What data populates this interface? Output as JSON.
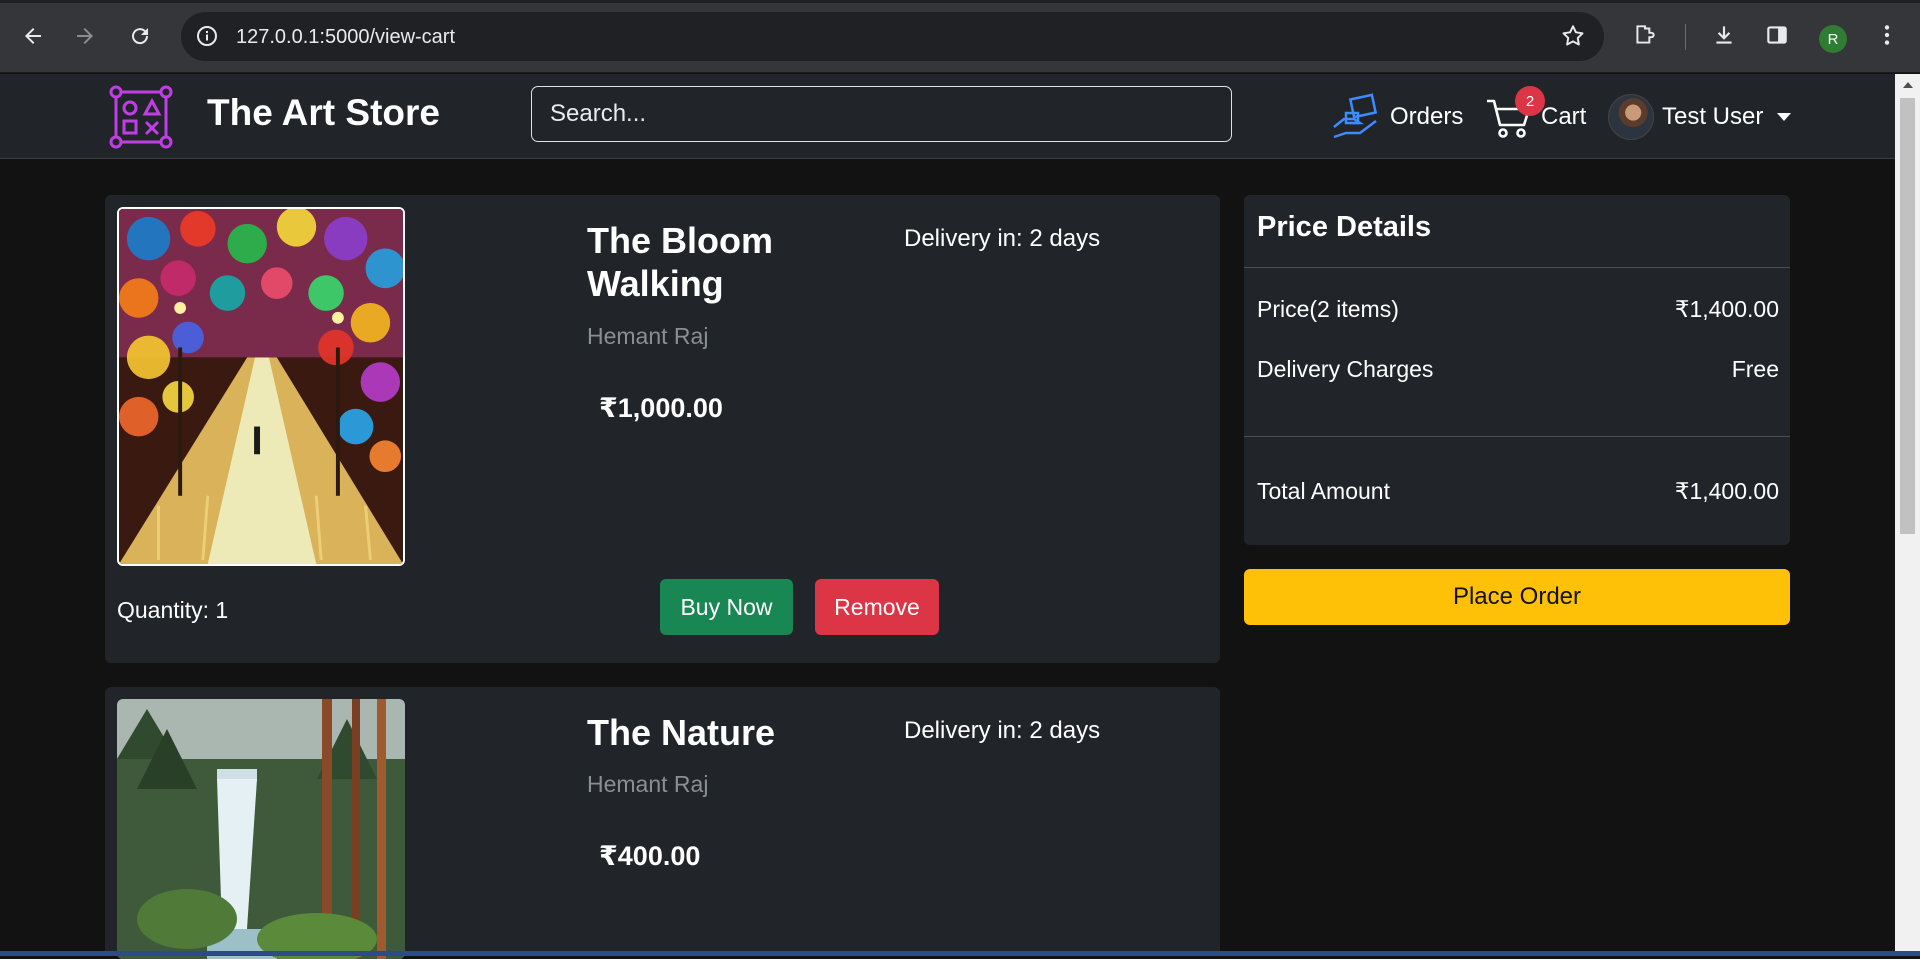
{
  "browser": {
    "url": "127.0.0.1:5000/view-cart",
    "profile_initial": "R"
  },
  "navbar": {
    "brand": "The Art Store",
    "search_placeholder": "Search...",
    "orders_label": "Orders",
    "cart_label": "Cart",
    "cart_count": "2",
    "user_name": "Test User"
  },
  "cart": {
    "items": [
      {
        "title": "The Bloom Walking",
        "artist": "Hemant Raj",
        "price": "₹1,000.00",
        "delivery": "Delivery in: 2 days",
        "quantity": "Quantity: 1",
        "buy_label": "Buy Now",
        "remove_label": "Remove"
      },
      {
        "title": "The Nature",
        "artist": "Hemant Raj",
        "price": "₹400.00",
        "delivery": "Delivery in: 2 days"
      }
    ]
  },
  "price_details": {
    "title": "Price Details",
    "price_label": "Price(2 items)",
    "price_value": "₹1,400.00",
    "delivery_label": "Delivery Charges",
    "delivery_value": "Free",
    "total_label": "Total Amount",
    "total_value": "₹1,400.00",
    "place_order_label": "Place Order"
  },
  "colors": {
    "buy": "#198754",
    "remove": "#dc3545",
    "place_order": "#ffc107",
    "card_bg": "#212529",
    "page_bg": "#121212"
  }
}
